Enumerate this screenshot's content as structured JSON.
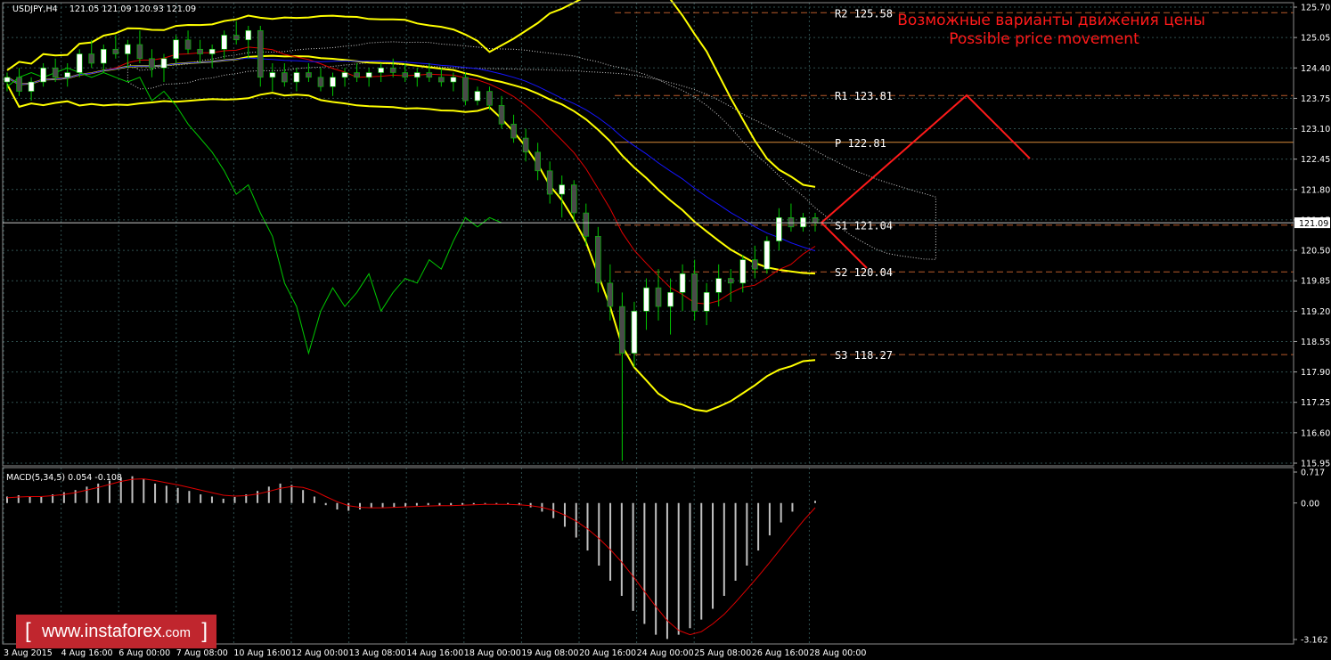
{
  "header": {
    "symbol": "USDJPY,H4",
    "ohlc": "121.05 121.09 120.93 121.09"
  },
  "forecast": {
    "title_ru": "Возможные варианты движения цены",
    "title_en": "Possible price movement"
  },
  "watermark": {
    "open_bracket": "[",
    "site": "www.instaforex",
    "tld": ".com",
    "close_bracket": "]"
  },
  "colors": {
    "background": "#000000",
    "grid": "#2f4f4f",
    "bull_candle": "#ffffff",
    "bear_candle": "#4a4a4a",
    "bollinger": "#ffff00",
    "red_ma": "#e00000",
    "blue_ma": "#1414ff",
    "chikou": "#00c800",
    "cloud": "#cfcfcf",
    "level_red": "#b85a2a",
    "level_orange": "#d88a3a",
    "forecast": "#ff1a1a",
    "macd_hist": "#c0c0c0",
    "macd_signal": "#e00000"
  },
  "chart_data": {
    "type": "candlestick",
    "symbol": "USDJPY",
    "timeframe": "H4",
    "ylim": [
      115.95,
      125.7
    ],
    "y_ticks": [
      "125.70",
      "125.05",
      "124.40",
      "123.75",
      "123.10",
      "122.45",
      "121.80",
      "121.15",
      "120.50",
      "119.85",
      "119.20",
      "118.55",
      "117.90",
      "117.25",
      "116.60",
      "115.95"
    ],
    "current_price": "121.09",
    "x_ticks": [
      "3 Aug 2015",
      "4 Aug 16:00",
      "6 Aug 00:00",
      "7 Aug 08:00",
      "10 Aug 16:00",
      "12 Aug 00:00",
      "13 Aug 08:00",
      "14 Aug 16:00",
      "18 Aug 00:00",
      "19 Aug 08:00",
      "20 Aug 16:00",
      "24 Aug 00:00",
      "25 Aug 08:00",
      "26 Aug 16:00",
      "28 Aug 00:00"
    ],
    "pivot_levels": [
      {
        "name": "R2",
        "label": "R2  125.58",
        "value": 125.58,
        "style": "dashed"
      },
      {
        "name": "R1",
        "label": "R1  123.81",
        "value": 123.81,
        "style": "dashed"
      },
      {
        "name": "P",
        "label": "P  122.81",
        "value": 122.81,
        "style": "solid"
      },
      {
        "name": "S1",
        "label": "S1  121.04",
        "value": 121.04,
        "style": "dashed"
      },
      {
        "name": "S2",
        "label": "S2  120.04",
        "value": 120.04,
        "style": "dashed"
      },
      {
        "name": "S3",
        "label": "S3  118.27",
        "value": 118.27,
        "style": "dashed"
      }
    ],
    "candles": [
      [
        124.1,
        124.3,
        123.9,
        124.2
      ],
      [
        124.2,
        124.4,
        123.8,
        123.9
      ],
      [
        123.9,
        124.2,
        123.7,
        124.1
      ],
      [
        124.1,
        124.5,
        124.0,
        124.4
      ],
      [
        124.4,
        124.6,
        124.1,
        124.2
      ],
      [
        124.2,
        124.5,
        124.0,
        124.3
      ],
      [
        124.3,
        124.8,
        124.2,
        124.7
      ],
      [
        124.7,
        125.0,
        124.4,
        124.5
      ],
      [
        124.5,
        124.9,
        124.3,
        124.8
      ],
      [
        124.8,
        125.1,
        124.6,
        124.7
      ],
      [
        124.7,
        125.0,
        124.4,
        124.9
      ],
      [
        124.9,
        125.2,
        124.5,
        124.6
      ],
      [
        124.6,
        124.8,
        124.2,
        124.4
      ],
      [
        124.4,
        124.7,
        124.1,
        124.6
      ],
      [
        124.6,
        125.1,
        124.5,
        125.0
      ],
      [
        125.0,
        125.2,
        124.7,
        124.8
      ],
      [
        124.8,
        125.0,
        124.5,
        124.7
      ],
      [
        124.7,
        124.9,
        124.4,
        124.8
      ],
      [
        124.8,
        125.2,
        124.6,
        125.1
      ],
      [
        125.1,
        125.4,
        124.9,
        125.0
      ],
      [
        125.0,
        125.3,
        124.6,
        125.2
      ],
      [
        125.2,
        125.3,
        124.0,
        124.2
      ],
      [
        124.2,
        124.5,
        123.9,
        124.3
      ],
      [
        124.3,
        124.5,
        124.0,
        124.1
      ],
      [
        124.1,
        124.4,
        123.9,
        124.3
      ],
      [
        124.3,
        124.5,
        124.1,
        124.2
      ],
      [
        124.2,
        124.4,
        123.9,
        124.0
      ],
      [
        124.0,
        124.3,
        123.8,
        124.2
      ],
      [
        124.2,
        124.4,
        124.0,
        124.3
      ],
      [
        124.3,
        124.5,
        124.1,
        124.2
      ],
      [
        124.2,
        124.4,
        124.0,
        124.3
      ],
      [
        124.3,
        124.5,
        124.1,
        124.4
      ],
      [
        124.4,
        124.6,
        124.2,
        124.3
      ],
      [
        124.3,
        124.5,
        124.1,
        124.2
      ],
      [
        124.2,
        124.4,
        124.0,
        124.3
      ],
      [
        124.3,
        124.5,
        124.1,
        124.2
      ],
      [
        124.2,
        124.4,
        124.0,
        124.1
      ],
      [
        124.1,
        124.3,
        123.9,
        124.2
      ],
      [
        124.2,
        124.3,
        123.6,
        123.7
      ],
      [
        123.7,
        124.0,
        123.6,
        123.9
      ],
      [
        123.9,
        124.0,
        123.5,
        123.6
      ],
      [
        123.6,
        123.8,
        123.1,
        123.2
      ],
      [
        123.2,
        123.4,
        122.8,
        122.9
      ],
      [
        122.9,
        123.1,
        122.4,
        122.6
      ],
      [
        122.6,
        122.8,
        122.0,
        122.2
      ],
      [
        122.2,
        122.4,
        121.5,
        121.7
      ],
      [
        121.7,
        122.1,
        121.2,
        121.9
      ],
      [
        121.9,
        122.0,
        121.1,
        121.3
      ],
      [
        121.3,
        121.5,
        120.6,
        120.8
      ],
      [
        120.8,
        121.0,
        119.6,
        119.8
      ],
      [
        119.8,
        120.2,
        119.0,
        119.3
      ],
      [
        119.3,
        119.6,
        116.0,
        118.3
      ],
      [
        118.3,
        119.4,
        118.0,
        119.2
      ],
      [
        119.2,
        119.9,
        118.8,
        119.7
      ],
      [
        119.7,
        120.1,
        119.0,
        119.3
      ],
      [
        119.3,
        119.9,
        118.7,
        119.6
      ],
      [
        119.6,
        120.2,
        119.2,
        120.0
      ],
      [
        120.0,
        120.3,
        119.0,
        119.2
      ],
      [
        119.2,
        119.8,
        118.9,
        119.6
      ],
      [
        119.6,
        120.2,
        119.3,
        119.9
      ],
      [
        119.9,
        120.1,
        119.4,
        119.8
      ],
      [
        119.8,
        120.4,
        119.6,
        120.3
      ],
      [
        120.3,
        120.6,
        119.9,
        120.1
      ],
      [
        120.1,
        120.8,
        120.0,
        120.7
      ],
      [
        120.7,
        121.4,
        120.5,
        121.2
      ],
      [
        121.2,
        121.5,
        120.9,
        121.0
      ],
      [
        121.0,
        121.3,
        120.9,
        121.2
      ],
      [
        121.2,
        121.3,
        120.9,
        121.09
      ]
    ],
    "macd": {
      "label": "MACD(5,34,5) 0.054 -0.108",
      "ylim": [
        -3.162,
        0.717
      ],
      "y_ticks": [
        "0.717",
        "0.00",
        "-3.162"
      ],
      "histogram": [
        0.15,
        0.18,
        0.16,
        0.14,
        0.2,
        0.25,
        0.3,
        0.38,
        0.45,
        0.52,
        0.6,
        0.62,
        0.55,
        0.45,
        0.4,
        0.35,
        0.28,
        0.2,
        0.15,
        0.1,
        0.14,
        0.2,
        0.28,
        0.38,
        0.45,
        0.42,
        0.3,
        0.15,
        -0.05,
        -0.15,
        -0.18,
        -0.15,
        -0.12,
        -0.1,
        -0.1,
        -0.08,
        -0.06,
        -0.05,
        -0.06,
        -0.05,
        -0.04,
        -0.03,
        -0.02,
        -0.02,
        -0.03,
        -0.05,
        -0.1,
        -0.2,
        -0.35,
        -0.55,
        -0.8,
        -1.1,
        -1.45,
        -1.8,
        -2.15,
        -2.5,
        -2.8,
        -3.05,
        -3.15,
        -3.05,
        -2.9,
        -2.7,
        -2.45,
        -2.15,
        -1.8,
        -1.45,
        -1.1,
        -0.75,
        -0.45,
        -0.2,
        0.0,
        0.05
      ],
      "signal": [
        0.12,
        0.14,
        0.15,
        0.15,
        0.17,
        0.2,
        0.24,
        0.3,
        0.36,
        0.43,
        0.5,
        0.55,
        0.56,
        0.52,
        0.47,
        0.42,
        0.36,
        0.3,
        0.24,
        0.18,
        0.16,
        0.17,
        0.21,
        0.27,
        0.34,
        0.38,
        0.36,
        0.28,
        0.15,
        0.03,
        -0.06,
        -0.1,
        -0.11,
        -0.11,
        -0.1,
        -0.09,
        -0.08,
        -0.07,
        -0.06,
        -0.06,
        -0.05,
        -0.04,
        -0.03,
        -0.03,
        -0.03,
        -0.04,
        -0.06,
        -0.1,
        -0.17,
        -0.28,
        -0.42,
        -0.6,
        -0.82,
        -1.08,
        -1.37,
        -1.7,
        -2.05,
        -2.4,
        -2.72,
        -2.95,
        -3.05,
        -2.98,
        -2.8,
        -2.58,
        -2.3,
        -2.0,
        -1.7,
        -1.38,
        -1.05,
        -0.72,
        -0.4,
        -0.108
      ]
    }
  }
}
